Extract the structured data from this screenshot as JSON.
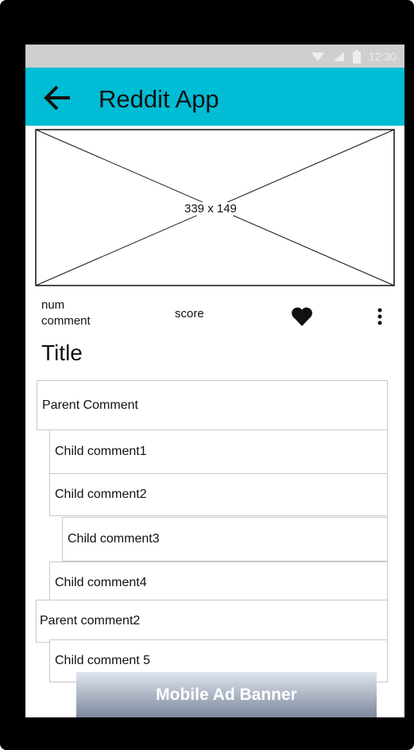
{
  "status_bar": {
    "time": "12:30"
  },
  "app_bar": {
    "title": "Reddit App"
  },
  "image": {
    "label": "339 x 149"
  },
  "meta": {
    "num_comment": "num\ncomment",
    "score": "score"
  },
  "post": {
    "title": "Title"
  },
  "comments": [
    {
      "text": "Parent Comment"
    },
    {
      "text": "Child comment1"
    },
    {
      "text": "Child comment2"
    },
    {
      "text": "Child comment3"
    },
    {
      "text": "Child comment4"
    },
    {
      "text": "Parent comment2"
    },
    {
      "text": "Child comment 5"
    }
  ],
  "ad": {
    "label": "Mobile Ad Banner"
  },
  "colors": {
    "app_bar": "#00bcd4",
    "status_bar": "#cfcfcf"
  }
}
